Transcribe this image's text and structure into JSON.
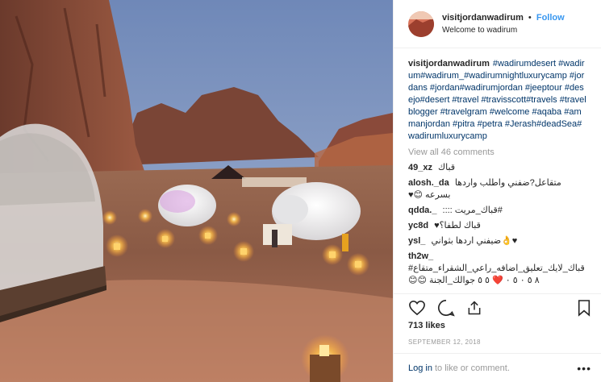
{
  "post": {
    "username": "visitjordanwadirum",
    "separator": "•",
    "follow_label": "Follow",
    "location": "Welcome to wadirum",
    "caption_user": "visitjordanwadirum",
    "caption_tags": "#wadirumdesert #wadirum#wadirum_#wadirumnightluxurycamp #jordans #jordan#wadirumjordan #jeeptour #desejo#desert #travel #travisscott#travels #travelblogger #travelgram #welcome #aqaba #ammanjordan #pitra #petra #Jerash#deadSea#wadirumluxurycamp",
    "view_all": "View all 46 comments",
    "comments": [
      {
        "user": "49_xz",
        "text": "قباك"
      },
      {
        "user": "alosh._da",
        "text": "متقاعل?ضفني واطلب واردها بسرعه 😊♥"
      },
      {
        "user": "qdda._",
        "text": "#قباك_مريت ::::"
      },
      {
        "user": "yc8d",
        "text": "قباك لطفا؟♥"
      },
      {
        "user": "ysl_",
        "text": "♥👌ضيفني اردها بثواني"
      },
      {
        "user": "th2w_",
        "text": "قباك_لايك_تعليق_اضافه_راعي_الشقراء_متقاع# ٨ ٥ ٠ ٥ ٠ ❤️ ٥ ٥ جوالك_الجنة 😊😊"
      }
    ],
    "likes": "713 likes",
    "date": "SEPTEMBER 12, 2018",
    "login_link": "Log in",
    "login_text": "to like or comment.",
    "more": "•••"
  },
  "icons": {
    "like": "heart-icon",
    "comment": "comment-icon",
    "share": "share-icon",
    "save": "bookmark-icon",
    "more": "more-options-icon"
  },
  "colors": {
    "link": "#3897f0",
    "hashtag": "#003569",
    "muted": "#999999"
  }
}
